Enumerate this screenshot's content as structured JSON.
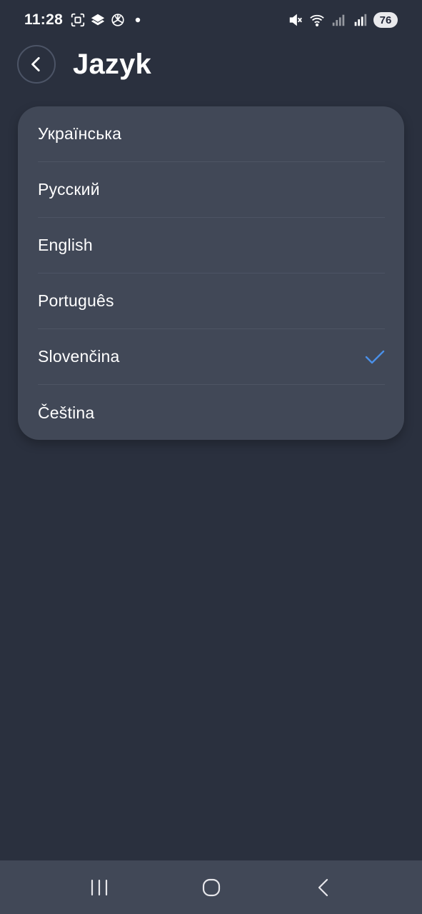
{
  "status_bar": {
    "time": "11:28",
    "battery": "76",
    "left_icons": [
      "screenshot-icon",
      "stacked-app-icon",
      "chatgpt-icon",
      "notification-dot-icon"
    ],
    "right_icons": [
      "mute-icon",
      "wifi-icon",
      "signal-icon",
      "signal-roaming-icon"
    ]
  },
  "header": {
    "title": "Jazyk",
    "back_icon": "chevron-left-icon"
  },
  "languages": {
    "items": [
      {
        "label": "Українська",
        "selected": false
      },
      {
        "label": "Русский",
        "selected": false
      },
      {
        "label": "English",
        "selected": false
      },
      {
        "label": "Português",
        "selected": false
      },
      {
        "label": "Slovenčina",
        "selected": true
      },
      {
        "label": "Čeština",
        "selected": false
      }
    ],
    "check_icon": "check-icon"
  },
  "nav_bar": {
    "buttons": [
      "recent-apps-icon",
      "home-icon",
      "back-icon"
    ]
  },
  "colors": {
    "background": "#2a303e",
    "card": "#414857",
    "accent_check": "#4a90e8",
    "text": "#ffffff"
  }
}
